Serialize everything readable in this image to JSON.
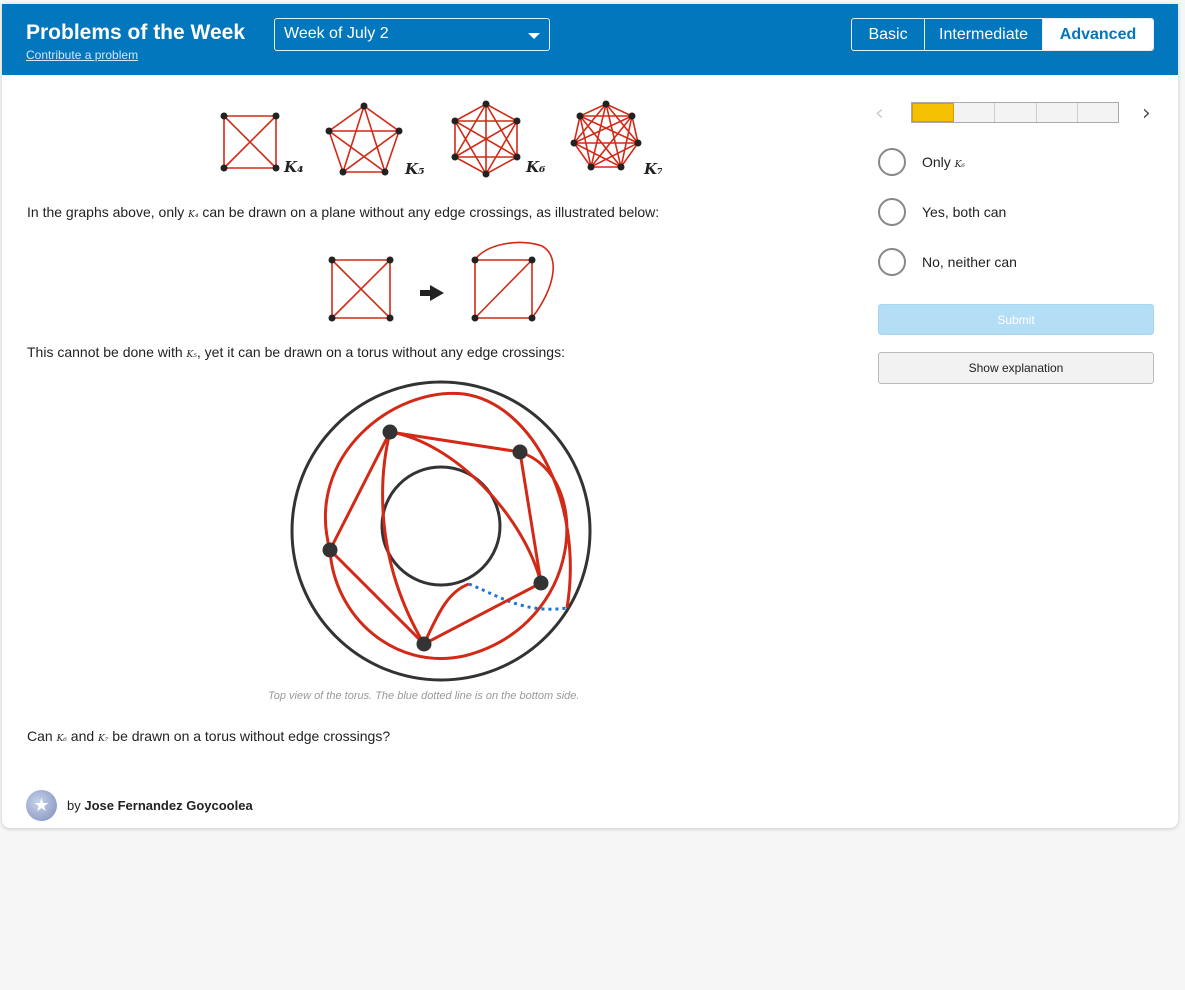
{
  "header": {
    "title": "Problems of the Week",
    "contribute_link": "Contribute a problem",
    "week_selector": "Week of July 2",
    "levels": [
      "Basic",
      "Intermediate",
      "Advanced"
    ],
    "active_level": "Advanced"
  },
  "figure_labels": {
    "k4": "K₄",
    "k5": "K₅",
    "k6": "K₆",
    "k7": "K₇"
  },
  "problem": {
    "p1_prefix": "In the graphs above, only ",
    "p1_math": "K₄",
    "p1_suffix": " can be drawn on a plane without any edge crossings, as illustrated below:",
    "p2_prefix": "This cannot be done with ",
    "p2_math": "K₅",
    "p2_suffix": ", yet it can be drawn on a torus without any edge crossings:",
    "caption": "Top view of the torus. The blue dotted line is on the bottom side.",
    "q_prefix": "Can ",
    "q_math1": "K₆",
    "q_mid": " and ",
    "q_math2": "K₇",
    "q_suffix": " be drawn on a torus without edge crossings?"
  },
  "author": {
    "by": "by ",
    "name": "Jose Fernandez Goycoolea"
  },
  "answers": {
    "progress_filled_fraction": 0.2,
    "options": [
      {
        "prefix": "Only ",
        "math": "K₆"
      },
      {
        "prefix": "Yes, both can",
        "math": ""
      },
      {
        "prefix": "No, neither can",
        "math": ""
      }
    ],
    "submit_label": "Submit",
    "explain_label": "Show explanation"
  },
  "colors": {
    "header_blue": "#0277bd",
    "edge_red": "#d22a17",
    "progress_yellow": "#f5c000",
    "dotted_blue": "#1976d2"
  },
  "icons": [
    "chevron-left-icon",
    "chevron-right-icon",
    "caret-down-icon",
    "arrow-right-icon",
    "avatar-icon"
  ]
}
